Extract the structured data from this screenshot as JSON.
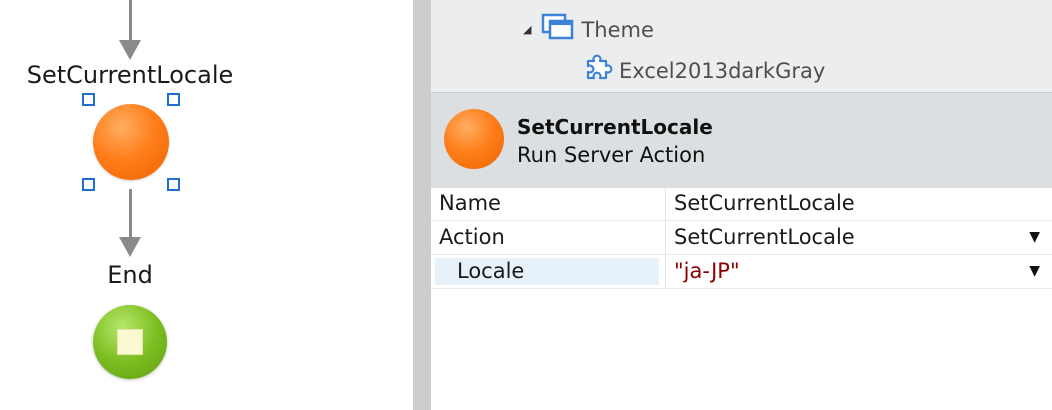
{
  "canvas": {
    "nodes": [
      {
        "label": "SetCurrentLocale",
        "type": "run-server-action"
      },
      {
        "label": "End",
        "type": "end"
      }
    ]
  },
  "tree": {
    "theme_label": "Theme",
    "theme_child_label": "Excel2013darkGray"
  },
  "selection": {
    "title": "SetCurrentLocale",
    "subtitle": "Run Server Action"
  },
  "properties": [
    {
      "name": "Name",
      "value": "SetCurrentLocale",
      "has_dropdown": false
    },
    {
      "name": "Action",
      "value": "SetCurrentLocale",
      "has_dropdown": true
    },
    {
      "name": "Locale",
      "value": "\"ja-JP\"",
      "has_dropdown": true,
      "is_expression": true,
      "indented": true
    }
  ],
  "icons": {
    "expander": "collapse-triangle-icon",
    "theme": "theme-windows-icon",
    "theme_child": "puzzle-piece-icon",
    "dropdown": "dropdown-triangle-icon"
  },
  "colors": {
    "action_node": "#ff7f1c",
    "end_node": "#7dbf22",
    "selection_handle": "#1f6fd1",
    "expression_text": "#8b0000",
    "tree_icon": "#3c82d6"
  }
}
